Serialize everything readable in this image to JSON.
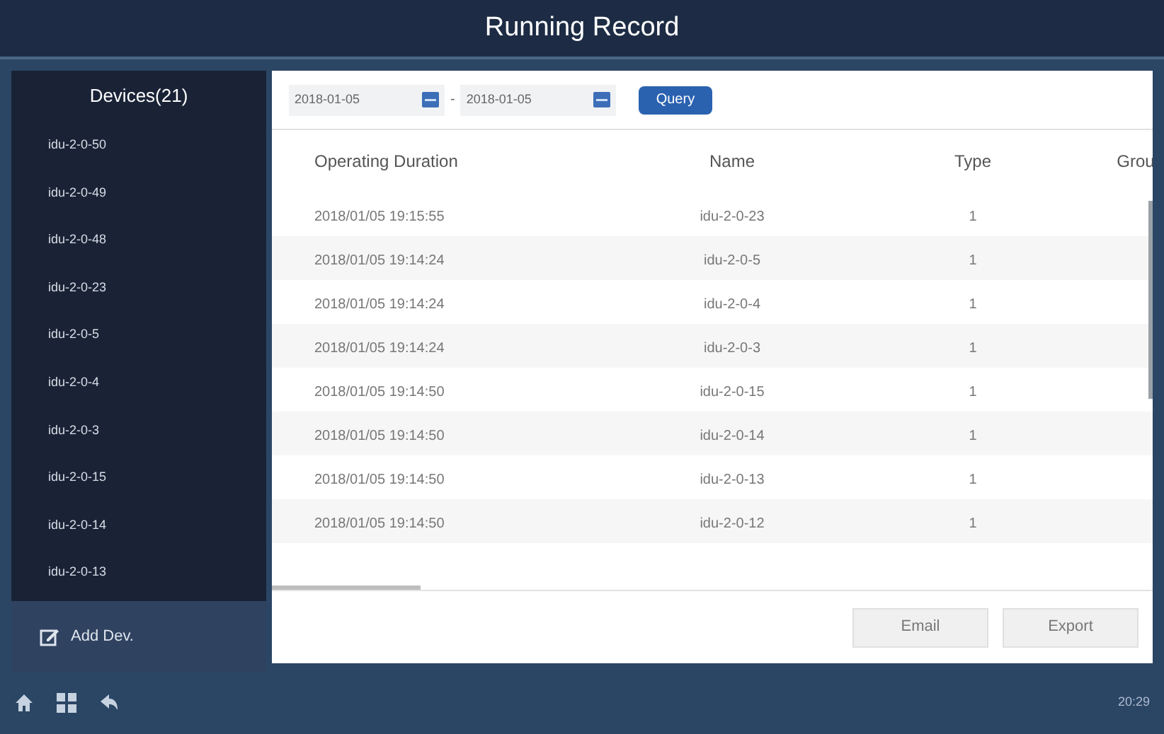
{
  "window": {
    "title": "Running Record"
  },
  "sidebar": {
    "title": "Devices(21)",
    "items": [
      {
        "label": "idu-2-0-50"
      },
      {
        "label": "idu-2-0-49"
      },
      {
        "label": "idu-2-0-48"
      },
      {
        "label": "idu-2-0-23"
      },
      {
        "label": "idu-2-0-5"
      },
      {
        "label": "idu-2-0-4"
      },
      {
        "label": "idu-2-0-3"
      },
      {
        "label": "idu-2-0-15"
      },
      {
        "label": "idu-2-0-14"
      },
      {
        "label": "idu-2-0-13"
      }
    ],
    "add_button": "Add Dev."
  },
  "filter": {
    "start_date": "2018-01-05",
    "separator": "-",
    "end_date": "2018-01-05",
    "query_button": "Query"
  },
  "table": {
    "columns": [
      "Operating Duration",
      "Name",
      "Type",
      "Grou"
    ],
    "rows": [
      [
        "2018/01/05 19:15:55",
        "idu-2-0-23",
        "1"
      ],
      [
        "2018/01/05 19:14:24",
        "idu-2-0-5",
        "1"
      ],
      [
        "2018/01/05 19:14:24",
        "idu-2-0-4",
        "1"
      ],
      [
        "2018/01/05 19:14:24",
        "idu-2-0-3",
        "1"
      ],
      [
        "2018/01/05 19:14:50",
        "idu-2-0-15",
        "1"
      ],
      [
        "2018/01/05 19:14:50",
        "idu-2-0-14",
        "1"
      ],
      [
        "2018/01/05 19:14:50",
        "idu-2-0-13",
        "1"
      ],
      [
        "2018/01/05 19:14:50",
        "idu-2-0-12",
        "1"
      ]
    ]
  },
  "actions": [
    "Email",
    "Export"
  ],
  "status_bar": {
    "time": "20:29"
  }
}
